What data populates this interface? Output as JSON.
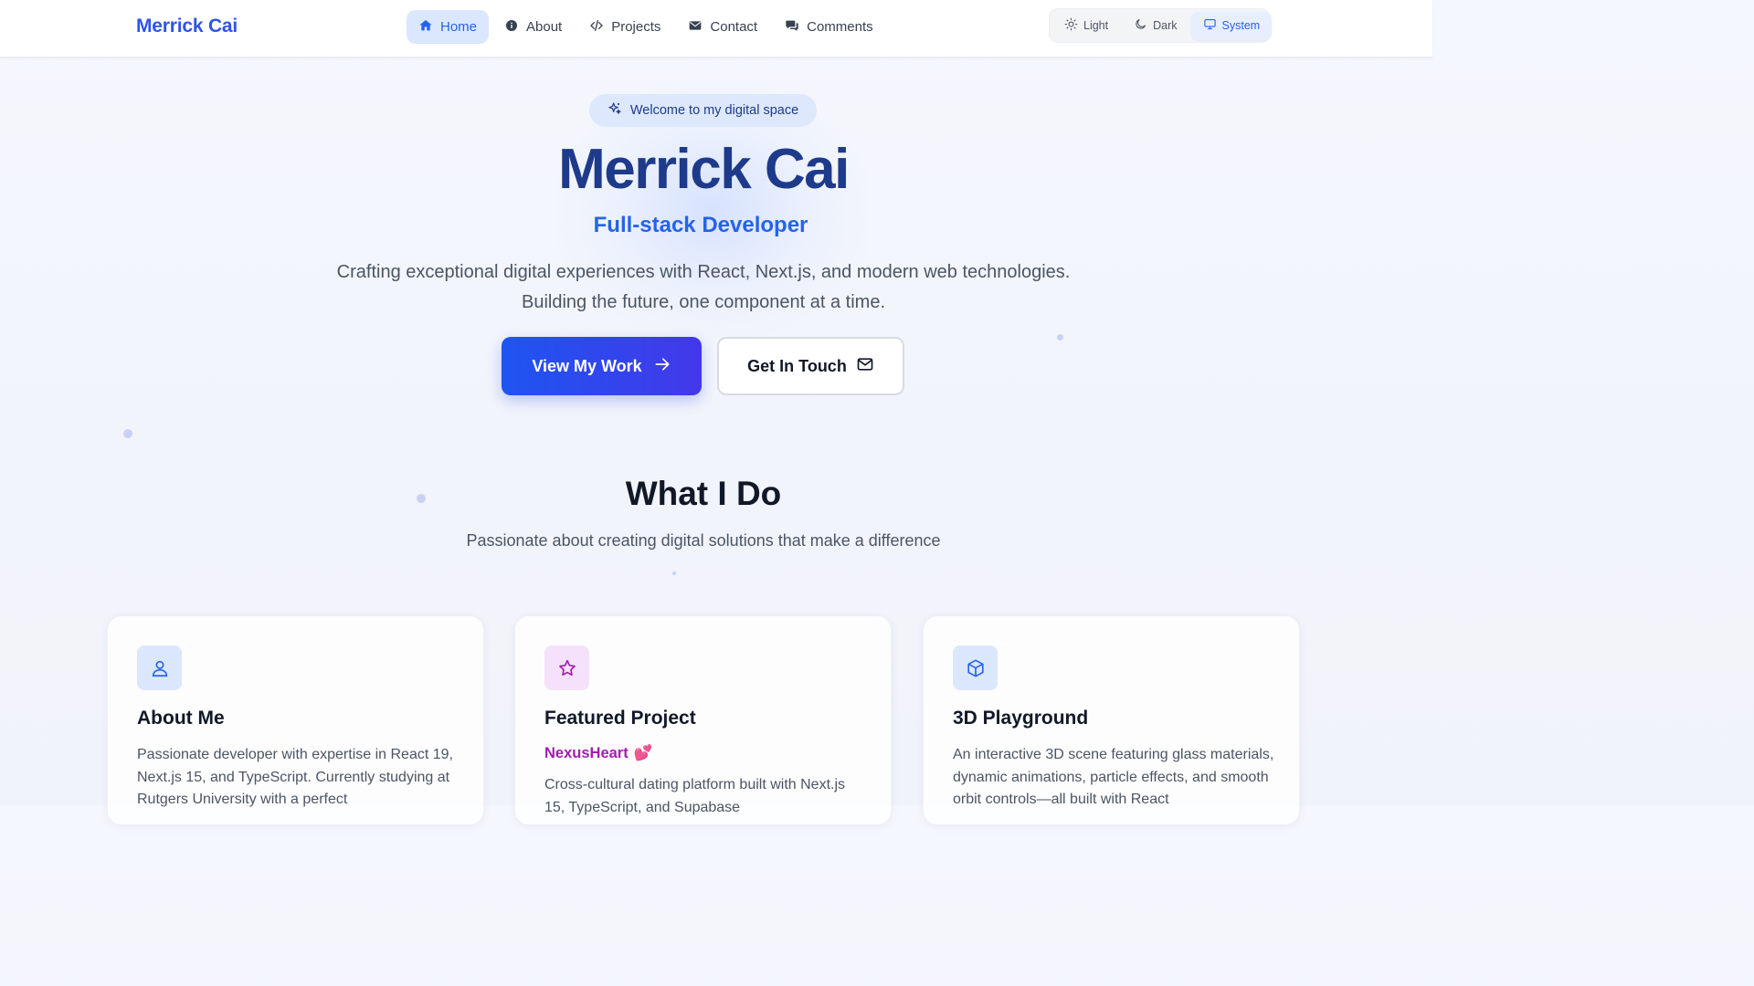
{
  "brand": "Merrick Cai",
  "nav": {
    "items": [
      {
        "label": "Home",
        "icon": "home-icon"
      },
      {
        "label": "About",
        "icon": "info-icon"
      },
      {
        "label": "Projects",
        "icon": "code-icon"
      },
      {
        "label": "Contact",
        "icon": "mail-icon"
      },
      {
        "label": "Comments",
        "icon": "chat-icon"
      }
    ],
    "active": "Home"
  },
  "theme": {
    "options": [
      {
        "label": "Light",
        "icon": "sun-icon"
      },
      {
        "label": "Dark",
        "icon": "moon-icon"
      },
      {
        "label": "System",
        "icon": "monitor-icon"
      }
    ],
    "selected": "System"
  },
  "hero": {
    "badge": "Welcome to my digital space",
    "title": "Merrick Cai",
    "subtitle": "Full-stack Developer",
    "description_line1": "Crafting exceptional digital experiences with React, Next.js, and modern web technologies.",
    "description_line2": "Building the future, one component at a time.",
    "primary_button": "View My Work",
    "secondary_button": "Get In Touch"
  },
  "section": {
    "title": "What I Do",
    "subtitle": "Passionate about creating digital solutions that make a difference"
  },
  "cards": [
    {
      "title": "About Me",
      "icon": "user-icon",
      "text": "Passionate developer with expertise in React 19, Next.js 15, and TypeScript. Currently studying at Rutgers University with a perfect"
    },
    {
      "title": "Featured Project",
      "icon": "star-icon",
      "highlight": "NexusHeart",
      "highlight_emoji": "💕",
      "text": "Cross-cultural dating platform built with Next.js 15, TypeScript, and Supabase"
    },
    {
      "title": "3D Playground",
      "icon": "cube-icon",
      "text": "An interactive 3D scene featuring glass materials, dynamic animations, particle effects, and smooth orbit controls—all built with React"
    }
  ],
  "colors": {
    "brand": "#2f54eb",
    "accent": "#2563eb",
    "hero_title": "#1e3a8a",
    "project_highlight": "#a21caf"
  }
}
